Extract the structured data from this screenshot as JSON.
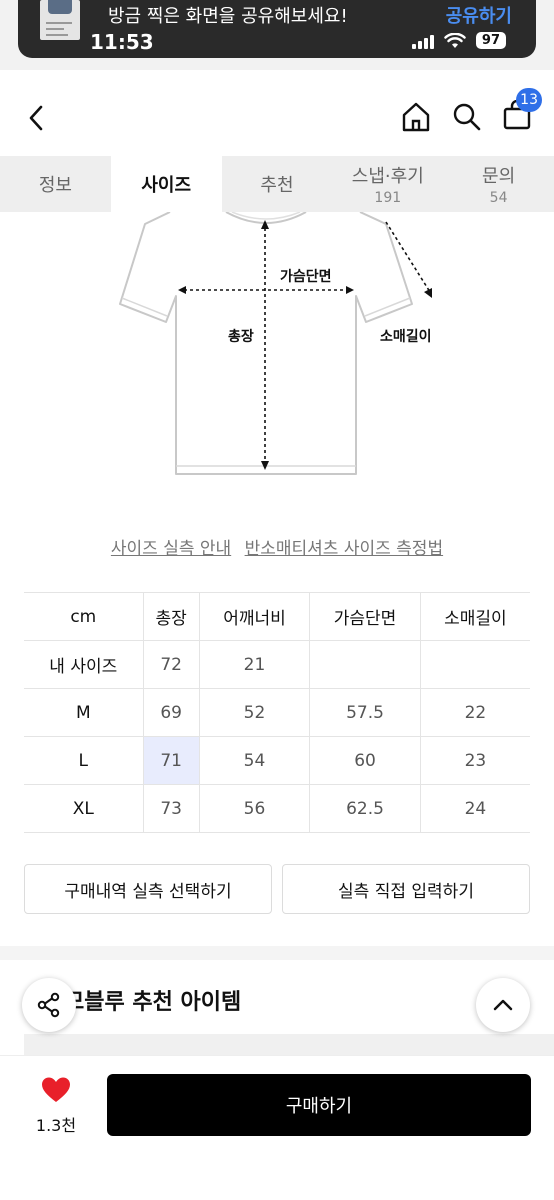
{
  "notification": {
    "text": "방금 찍은 화면을 공유해보세요!",
    "action": "공유하기"
  },
  "status_bar": {
    "time": "11:53",
    "battery": "97"
  },
  "header": {
    "cart_count": "13"
  },
  "tabs": [
    {
      "label": "정보",
      "count": ""
    },
    {
      "label": "사이즈",
      "count": ""
    },
    {
      "label": "추천",
      "count": ""
    },
    {
      "label": "스냅·후기",
      "count": "191"
    },
    {
      "label": "문의",
      "count": "54"
    }
  ],
  "diagram": {
    "chest_label": "가슴단면",
    "length_label": "총장",
    "sleeve_label": "소매길이"
  },
  "size_links": {
    "guide": "사이즈 실측 안내",
    "method": "반소매티셔츠 사이즈 측정법"
  },
  "size_table": {
    "headers": [
      "cm",
      "총장",
      "어깨너비",
      "가슴단면",
      "소매길이"
    ],
    "rows": [
      [
        "내 사이즈",
        "72",
        "21",
        "",
        ""
      ],
      [
        "M",
        "69",
        "52",
        "57.5",
        "22"
      ],
      [
        "L",
        "71",
        "54",
        "60",
        "23"
      ],
      [
        "XL",
        "73",
        "56",
        "62.5",
        "24"
      ]
    ]
  },
  "buttons": {
    "select_history": "구매내역 실측 선택하기",
    "manual_input": "실측 직접 입력하기"
  },
  "recommend": {
    "title": "모블루 추천 아이템"
  },
  "bottom": {
    "like_count": "1.3천",
    "buy_label": "구매하기",
    "heart_color": "#e8202a"
  }
}
